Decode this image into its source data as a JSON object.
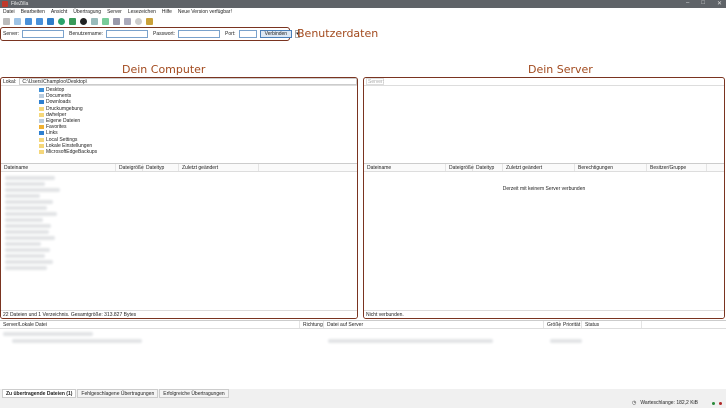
{
  "window": {
    "title": "FileZilla"
  },
  "menu": [
    "Datei",
    "Bearbeiten",
    "Ansicht",
    "Übertragung",
    "Server",
    "Lesezeichen",
    "Hilfe",
    "Neue Version verfügbar!"
  ],
  "quickconnect": {
    "server_label": "Server:",
    "user_label": "Benutzername:",
    "pass_label": "Passwort:",
    "port_label": "Port:",
    "connect": "Verbinden",
    "dropdown": "▾",
    "annotation": "Benutzerdaten"
  },
  "annotations": {
    "local": "Dein Computer",
    "remote": "Dein Server"
  },
  "local": {
    "label": "Lokal:",
    "path": "C:\\Users\\Champloo\\Desktop\\",
    "tree": [
      "Desktop",
      "Documents",
      "Downloads",
      "Druckumgebung",
      "dwhelper",
      "Eigene Dateien",
      "Favorites",
      "Links",
      "Local Settings",
      "Lokale Einstellungen",
      "MicrosoftEdgeBackups"
    ],
    "columns": [
      "Dateiname",
      "Dateigröße",
      "Dateityp",
      "Zuletzt geändert"
    ],
    "status": "22 Dateien und 1 Verzeichnis. Gesamtgröße: 313.827 Bytes"
  },
  "remote": {
    "label": "Server:",
    "columns": [
      "Dateiname",
      "Dateigröße",
      "Dateityp",
      "Zuletzt geändert",
      "Berechtigungen",
      "Besitzer/Gruppe"
    ],
    "empty": "Derzeit mit keinem Server verbunden",
    "status": "Nicht verbunden."
  },
  "queue": {
    "columns": [
      "Server/Lokale Datei",
      "Richtung",
      "Datei auf Server",
      "Größe",
      "Priorität",
      "Status"
    ]
  },
  "tabs": [
    "Zu übertragende Dateien (1)",
    "Fehlgeschlagene Übertragungen",
    "Erfolgreiche Übertragungen"
  ],
  "statusbar": {
    "queue": "Warteschlange: 182,2 KiB"
  }
}
